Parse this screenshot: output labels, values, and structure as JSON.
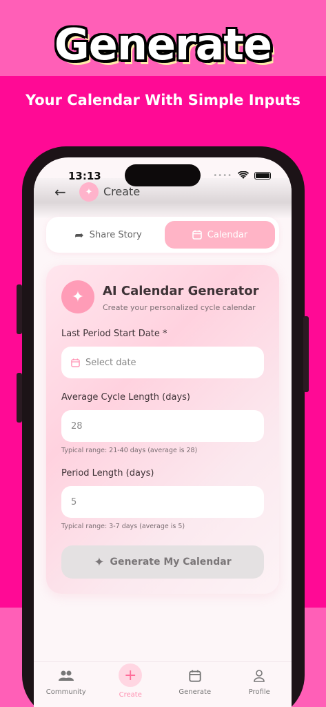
{
  "hero": {
    "title": "Generate",
    "subtitle": "Your Calendar With Simple Inputs"
  },
  "status_bar": {
    "time": "13:13"
  },
  "header": {
    "title": "Create",
    "back_icon": "arrow-left-icon",
    "icon": "magic-wand-icon"
  },
  "tabs": [
    {
      "label": "Share Story",
      "icon": "share-arrow-icon",
      "active": false
    },
    {
      "label": "Calendar",
      "icon": "calendar-icon",
      "active": true
    }
  ],
  "card": {
    "title": "AI Calendar Generator",
    "subtitle": "Create your personalized cycle calendar",
    "icon": "magic-wand-icon",
    "fields": {
      "last_period": {
        "label": "Last Period Start Date *",
        "placeholder": "Select date",
        "icon": "calendar-icon"
      },
      "cycle_length": {
        "label": "Average Cycle Length (days)",
        "placeholder": "28",
        "hint": "Typical range: 21-40 days (average is 28)"
      },
      "period_length": {
        "label": "Period Length (days)",
        "placeholder": "5",
        "hint": "Typical range: 3-7 days (average is 5)"
      }
    },
    "button": {
      "label": "Generate My Calendar",
      "icon": "magic-wand-icon"
    }
  },
  "tabbar": [
    {
      "label": "Community",
      "icon": "people-icon"
    },
    {
      "label": "Create",
      "icon": "plus-icon",
      "active": true
    },
    {
      "label": "Generate",
      "icon": "calendar-icon"
    },
    {
      "label": "Profile",
      "icon": "person-icon"
    }
  ],
  "colors": {
    "background": "#ff5fb7",
    "accent": "#ff0a95",
    "tab_active": "#ffb4c6",
    "card_icon": "#ff9cb7"
  }
}
